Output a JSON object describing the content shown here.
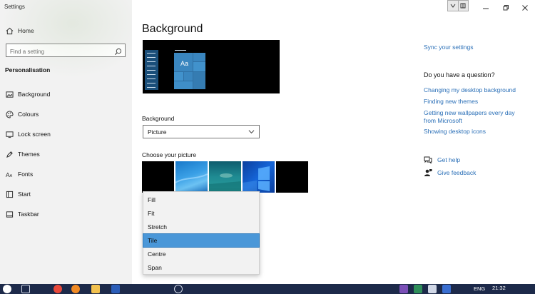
{
  "window": {
    "title": "Settings"
  },
  "sidebar": {
    "home_label": "Home",
    "search": {
      "placeholder": "Find a setting",
      "value": ""
    },
    "section_title": "Personalisation",
    "items": [
      {
        "label": "Background",
        "icon": "image-icon"
      },
      {
        "label": "Colours",
        "icon": "palette-icon"
      },
      {
        "label": "Lock screen",
        "icon": "lock-screen-icon"
      },
      {
        "label": "Themes",
        "icon": "themes-icon"
      },
      {
        "label": "Fonts",
        "icon": "fonts-icon"
      },
      {
        "label": "Start",
        "icon": "start-icon"
      },
      {
        "label": "Taskbar",
        "icon": "taskbar-icon"
      }
    ]
  },
  "main": {
    "title": "Background",
    "preview_tile_text": "Aa",
    "background_label": "Background",
    "background_value": "Picture",
    "choose_label": "Choose your picture",
    "fit_options": [
      "Fill",
      "Fit",
      "Stretch",
      "Tile",
      "Centre",
      "Span"
    ],
    "fit_selected": "Tile"
  },
  "right_panel": {
    "sync_link": "Sync your settings",
    "question_title": "Do you have a question?",
    "links": [
      "Changing my desktop background",
      "Finding new themes",
      "Getting new wallpapers every day from Microsoft",
      "Showing desktop icons"
    ],
    "get_help": "Get help",
    "give_feedback": "Give feedback"
  },
  "taskbar": {
    "lang": "ENG",
    "time": "21:32"
  },
  "colors": {
    "accent": "#4a97d8",
    "link": "#2a6fb7",
    "sidebar_bg": "#f2f2f2",
    "taskbar_bg": "#1d2a4a"
  }
}
